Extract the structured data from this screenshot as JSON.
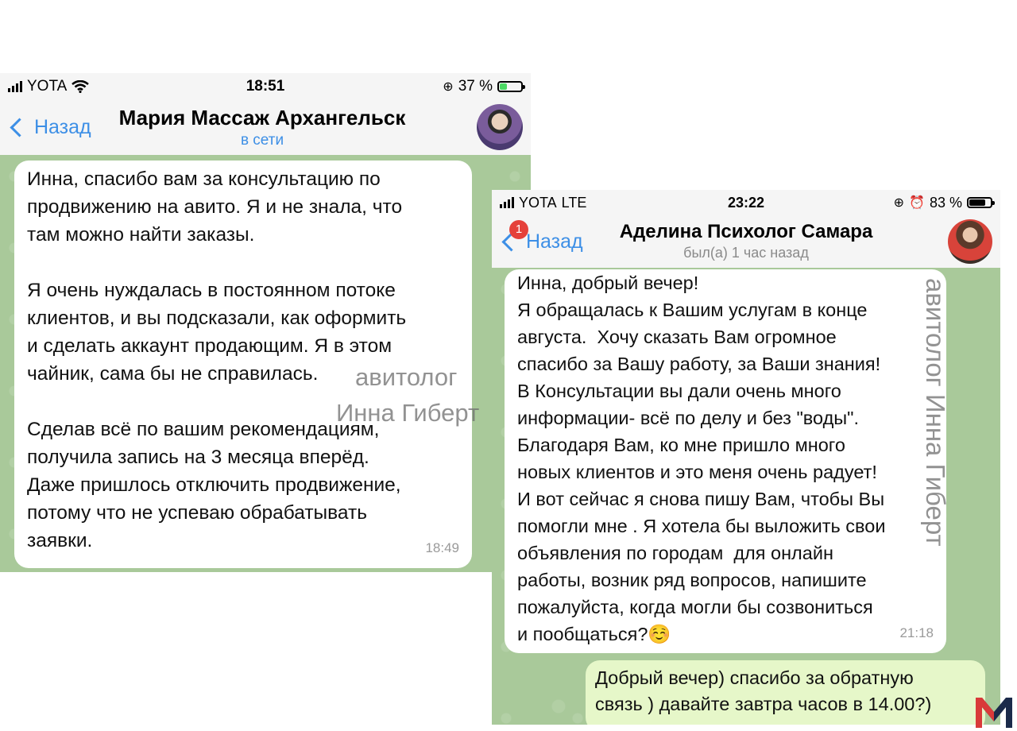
{
  "screens": [
    {
      "status": {
        "carrier": "YOTA",
        "time": "18:51",
        "battery": "37 %",
        "battery_level": 0.37,
        "battery_color": "#4cd964"
      },
      "header": {
        "back_label": "Назад",
        "title": "Мария Массаж Архангельск",
        "subtitle": "в сети"
      },
      "message": {
        "paragraphs": [
          [
            "Инна, спасибо вам за консультацию по",
            "продвижению на авито. Я и не знала, что",
            "там можно найти заказы."
          ],
          [
            "Я очень нуждалась в постоянном потоке",
            "клиентов, и вы подсказали, как оформить",
            "и сделать аккаунт продающим. Я в этом",
            "чайник, сама бы не справилась."
          ],
          [
            "Сделав всё по вашим рекомендациям,",
            "получила запись на 3 месяца вперёд.",
            "Даже пришлось отключить продвижение,",
            "потому что не успеваю обрабатывать",
            "заявки."
          ]
        ],
        "time": "18:49"
      }
    },
    {
      "status": {
        "carrier": "YOTA",
        "network": "LTE",
        "time": "23:22",
        "battery": "83 %",
        "battery_level": 0.83,
        "battery_color": "#000000"
      },
      "header": {
        "back_label": "Назад",
        "badge": "1",
        "title": "Аделина Психолог Самара",
        "subtitle": "был(а) 1 час назад"
      },
      "message": {
        "lines": [
          "Инна, добрый вечер!",
          "Я обращалась к Вашим услугам в конце",
          "августа.  Хочу сказать Вам огромное",
          "спасибо за Вашу работу, за Ваши знания!",
          "В Консультации вы дали очень много",
          "информации- всё по делу и без \"воды\".",
          "Благодаря Вам, ко мне пришло много",
          "новых клиентов и это меня очень радует!",
          "И вот сейчас я снова пишу Вам, чтобы Вы",
          "помогли мне . Я хотела бы выложить свои",
          "объявления по городам  для онлайн",
          "работы, возник ряд вопросов, напишите",
          "пожалуйста, когда могли бы созвониться",
          "и пообщаться?☺️"
        ],
        "time": "21:18"
      },
      "reply": {
        "lines": [
          "Добрый вечер) спасибо за обратную",
          "связь ) давайте завтра часов в 14.00?)"
        ]
      }
    }
  ],
  "watermarks": {
    "line1": "авитолог",
    "line2": "Инна Гиберт",
    "vertical": "авитолог Инна Гиберт"
  },
  "colors": {
    "accent": "#3d8fe6",
    "chat_bg": "#a9c99a",
    "outgoing": "#e6f7c9",
    "badge": "#e5413a"
  },
  "icons": [
    "signal-icon",
    "wifi-icon",
    "orientation-lock-icon",
    "alarm-icon",
    "battery-icon",
    "chevron-left-icon",
    "brand-logo-m"
  ]
}
